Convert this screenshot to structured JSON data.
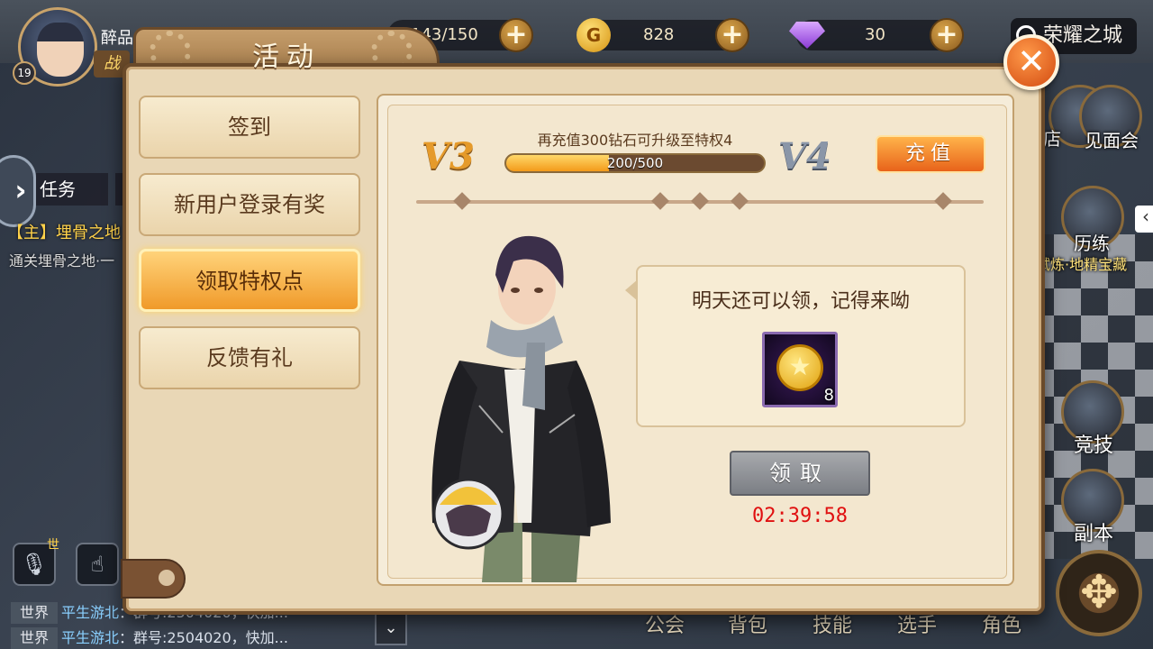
{
  "player": {
    "name": "醉品",
    "level": "19",
    "battle_tag": "战"
  },
  "resources": {
    "stamina": "143/150",
    "gold": "828",
    "gold_icon_glyph": "G",
    "diamonds": "30",
    "plus_glyph": "+"
  },
  "location": {
    "city": "荣耀之城"
  },
  "left_hud": {
    "arrow_glyph": "›",
    "task_tab": "任务",
    "quest_title": "【主】埋骨之地",
    "quest_desc": "通关埋骨之地·一"
  },
  "right_hud": {
    "meet": "见面会",
    "shop_partial": "店",
    "training": "历练",
    "training_sub": "试炼·地精宝藏",
    "arena": "竞技",
    "dungeon": "副本",
    "collapse_glyph": "‹"
  },
  "chat": {
    "world_sup": "世",
    "lines": [
      {
        "tag": "世界",
        "name": "平生游北",
        "text": "：群号:2504020，快加..."
      },
      {
        "tag": "世界",
        "name": "平生游北",
        "text": "：群号:2504020，快加..."
      }
    ]
  },
  "bottom_nav": {
    "guild": "公会",
    "bag": "背包",
    "skills": "技能",
    "select": "选手",
    "role": "角色",
    "expand_glyph": "⌄",
    "joystick_glyph": "✥"
  },
  "panel": {
    "title": "活动",
    "close_glyph": "✕",
    "tabs": [
      {
        "label": "签到",
        "active": false
      },
      {
        "label": "新用户登录有奖",
        "active": false
      },
      {
        "label": "领取特权点",
        "active": true
      },
      {
        "label": "反馈有礼",
        "active": false
      }
    ]
  },
  "vip": {
    "current": "V3",
    "next": "V4",
    "hint": "再充值300钻石可升级至特权4",
    "progress_text": "200/500",
    "progress_fraction": 0.4,
    "recharge_label": "充值"
  },
  "reward": {
    "message": "明天还可以领，记得来呦",
    "item_icon": "star-coin-icon",
    "coin_glyph": "★",
    "quantity": "8",
    "claim_label": "领取",
    "countdown": "02:39:58"
  },
  "colors": {
    "accent_orange": "#f09a2a",
    "timer_red": "#e01010",
    "panel_bg": "#e9d7b6"
  }
}
